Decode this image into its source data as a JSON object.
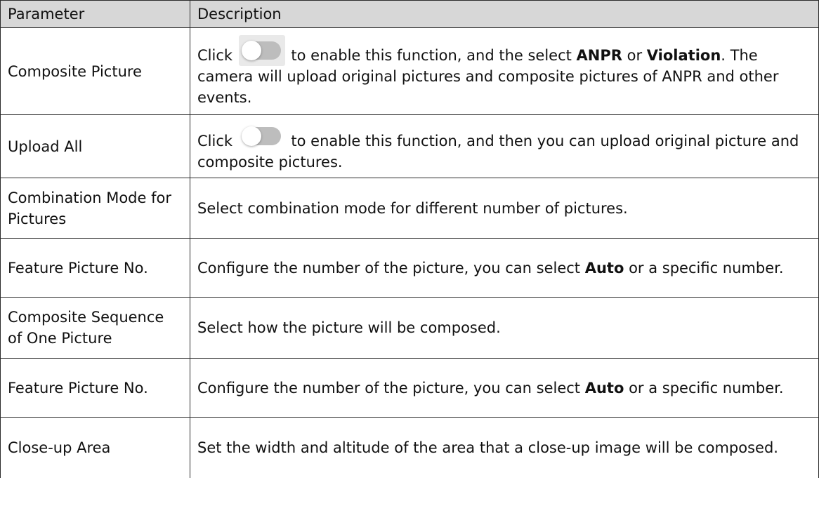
{
  "header": {
    "parameter": "Parameter",
    "description": "Description"
  },
  "rows": [
    {
      "parameter": "Composite Picture",
      "desc": {
        "click": "Click",
        "toggle_icon": "toggle-switch-icon",
        "part1": " to enable this function, and the select ",
        "bold1": "ANPR",
        "part2": "  or ",
        "bold2": "Violation",
        "part3": ". The camera will upload original pictures and composite pictures of ANPR and other events."
      }
    },
    {
      "parameter": "Upload All",
      "desc": {
        "click": "Click",
        "toggle_icon": "toggle-switch-icon",
        "part1": " to enable this function, and then you can upload original picture and composite pictures."
      }
    },
    {
      "parameter": "Combination Mode for Pictures",
      "desc": {
        "text": "Select combination mode for different number of pictures."
      }
    },
    {
      "parameter": "Feature Picture No.",
      "desc": {
        "part1": "Configure the number of the picture, you can select ",
        "bold1": "Auto",
        "part2": "  or a specific number."
      }
    },
    {
      "parameter": "Composite Sequence of One Picture",
      "desc": {
        "text": "Select how the picture will be composed."
      }
    },
    {
      "parameter": "Feature Picture No.",
      "desc": {
        "part1": "Configure the number of the picture, you can select ",
        "bold1": "Auto",
        "part2": "  or a specific number."
      }
    },
    {
      "parameter": "Close-up Area",
      "desc": {
        "text": "Set the width and altitude of the area that a close-up image will be composed."
      }
    }
  ]
}
